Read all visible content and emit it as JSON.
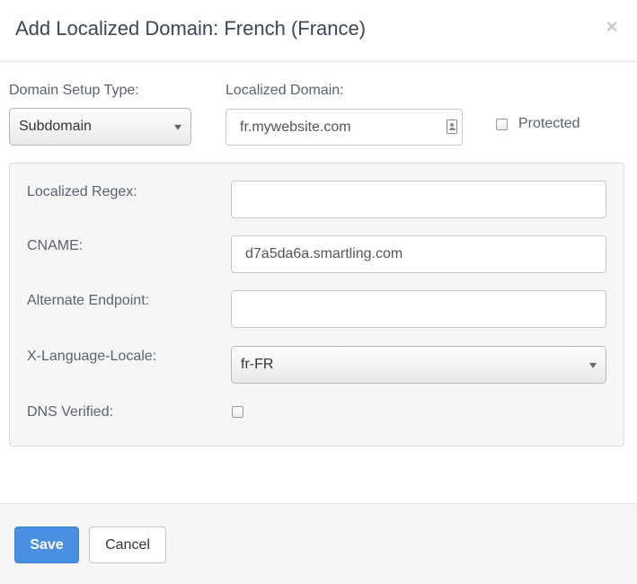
{
  "dialog": {
    "title": "Add Localized Domain: French (France)",
    "close_icon": "×"
  },
  "top_row": {
    "domain_setup_type_label": "Domain Setup Type:",
    "domain_setup_type_value": "Subdomain",
    "localized_domain_label": "Localized Domain:",
    "localized_domain_value": "fr.mywebsite.com",
    "protected_label": "Protected",
    "protected_checked": false
  },
  "panel": {
    "localized_regex_label": "Localized Regex:",
    "localized_regex_value": "",
    "cname_label": "CNAME:",
    "cname_value": "d7a5da6a.smartling.com",
    "alternate_endpoint_label": "Alternate Endpoint:",
    "alternate_endpoint_value": "",
    "x_language_locale_label": "X-Language-Locale:",
    "x_language_locale_value": "fr-FR",
    "dns_verified_label": "DNS Verified:",
    "dns_verified_checked": false
  },
  "footer": {
    "save_label": "Save",
    "cancel_label": "Cancel"
  },
  "colors": {
    "primary": "#4a90e2",
    "panel_bg": "#f6f6f6"
  },
  "icons": {
    "close": "close-icon",
    "contact": "contact-card-icon",
    "dropdown": "chevron-down-icon"
  }
}
